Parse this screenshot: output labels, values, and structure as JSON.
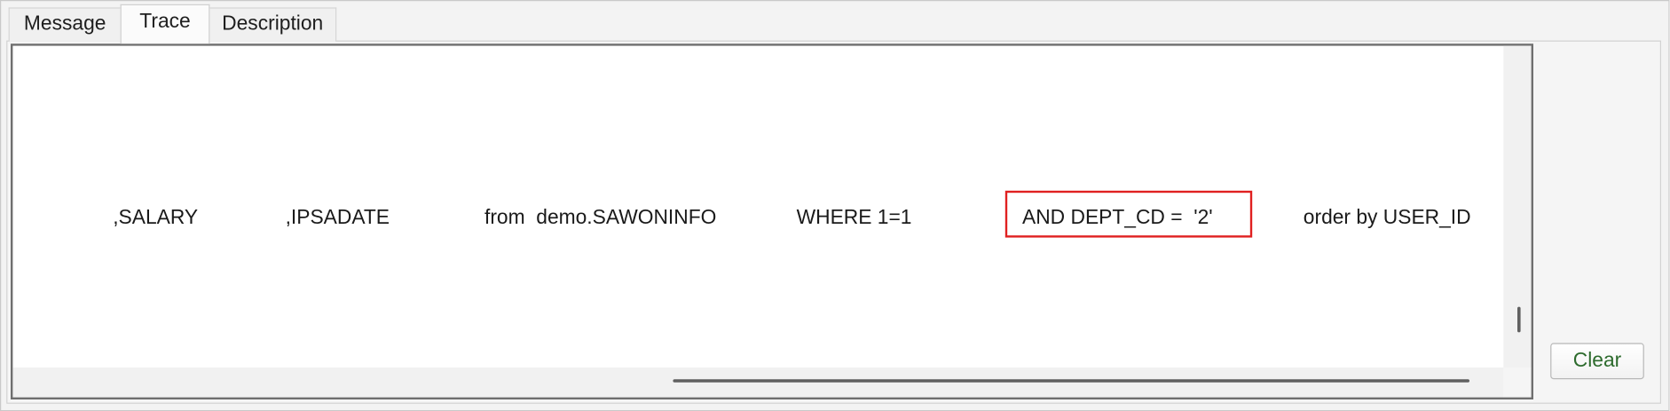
{
  "tabs": [
    {
      "label": "Message",
      "active": false
    },
    {
      "label": "Trace",
      "active": true
    },
    {
      "label": "Description",
      "active": false
    }
  ],
  "trace": {
    "segments": [
      ",SALARY",
      ",IPSADATE",
      "from  demo.SAWONINFO",
      "WHERE 1=1",
      "AND DEPT_CD =  '2'",
      "order by USER_ID"
    ],
    "highlighted_segment": "AND DEPT_CD =  '2'",
    "highlight_color": "#e02020"
  },
  "buttons": {
    "clear_label": "Clear"
  }
}
